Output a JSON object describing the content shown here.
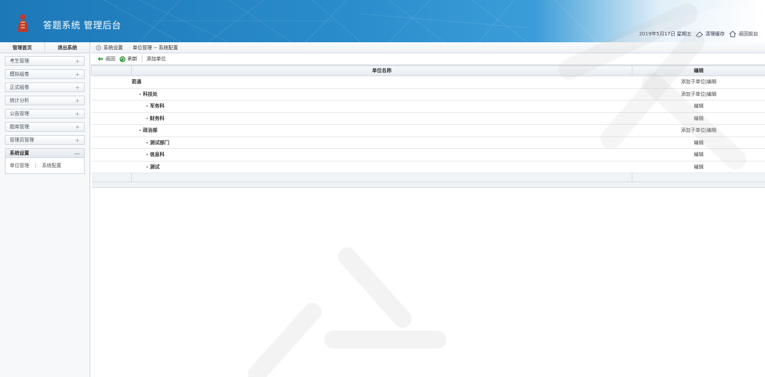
{
  "header": {
    "title": "答题系统 管理后台",
    "date": "2019年5月17日 星期五",
    "clear_cache": "清理缓存",
    "back_frontend": "返回前台"
  },
  "sidebar": {
    "top": [
      "管理首页",
      "退出系统"
    ],
    "items": [
      {
        "label": "考生管理",
        "sign": "+"
      },
      {
        "label": "模拟组卷",
        "sign": "+"
      },
      {
        "label": "正式组卷",
        "sign": "+"
      },
      {
        "label": "统计分析",
        "sign": "+"
      },
      {
        "label": "公告管理",
        "sign": "+"
      },
      {
        "label": "题库管理",
        "sign": "+"
      },
      {
        "label": "管理员管理",
        "sign": "+"
      },
      {
        "label": "系统设置",
        "sign": "—"
      }
    ],
    "submenu": {
      "unit": "单位管理",
      "sep": "|",
      "config": "系统配置"
    }
  },
  "breadcrumb": {
    "section": "系统设置",
    "path": "单位管理 -- 系统配置"
  },
  "toolbar": {
    "back": "返回",
    "refresh": "刷新",
    "add": "添加单位"
  },
  "table": {
    "headers": [
      "单位名称",
      "编辑"
    ],
    "rows": [
      {
        "name": "君通",
        "action": "添加子单位|编辑"
      },
      {
        "name": "- 科技处",
        "action": "添加子单位|编辑"
      },
      {
        "name": "- 军务科",
        "action": "编辑"
      },
      {
        "name": "- 财务科",
        "action": "编辑"
      },
      {
        "name": "- 政治部",
        "action": "添加子单位|编辑"
      },
      {
        "name": "- 测试部门",
        "action": "编辑"
      },
      {
        "name": "- 信息科",
        "action": "编辑"
      },
      {
        "name": "- 测试",
        "action": "编辑"
      }
    ]
  },
  "colors": {
    "header_blue": "#2a8ccc",
    "accent_green": "#4caf50"
  }
}
